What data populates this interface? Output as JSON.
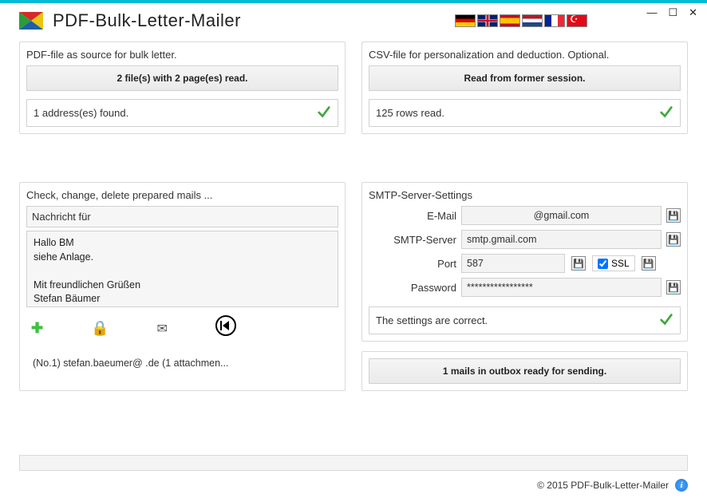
{
  "app": {
    "title": "PDF-Bulk-Letter-Mailer"
  },
  "window": {
    "min": "—",
    "max": "☐",
    "close": "✕"
  },
  "langs": [
    "de",
    "uk",
    "es",
    "nl",
    "fr",
    "tr"
  ],
  "pdf_panel": {
    "label": "PDF-file as source for bulk letter.",
    "button": "2 file(s) with 2 page(es) read.",
    "status": "1 address(es) found."
  },
  "csv_panel": {
    "label": "CSV-file for personalization and deduction. Optional.",
    "button": "Read from former session.",
    "status": "125 rows read."
  },
  "mails_panel": {
    "label": "Check, change, delete prepared mails ...",
    "subject": "Nachricht für",
    "body": "Hallo   BM\nsiehe Anlage.\n\nMit freundlichen Grüßen\nStefan Bäumer",
    "outbox": "(No.1) stefan.baeumer@                                .de (1 attachmen..."
  },
  "smtp": {
    "title": "SMTP-Server-Settings",
    "email_label": "E-Mail",
    "email_value": "@gmail.com",
    "server_label": "SMTP-Server",
    "server_value": "smtp.gmail.com",
    "port_label": "Port",
    "port_value": "587",
    "ssl_label": "SSL",
    "ssl_checked": true,
    "password_label": "Password",
    "password_value": "*****************",
    "status": "The settings are correct."
  },
  "send": {
    "button": "1 mails in outbox ready for sending."
  },
  "footer": {
    "copyright": "© 2015 PDF-Bulk-Letter-Mailer"
  }
}
